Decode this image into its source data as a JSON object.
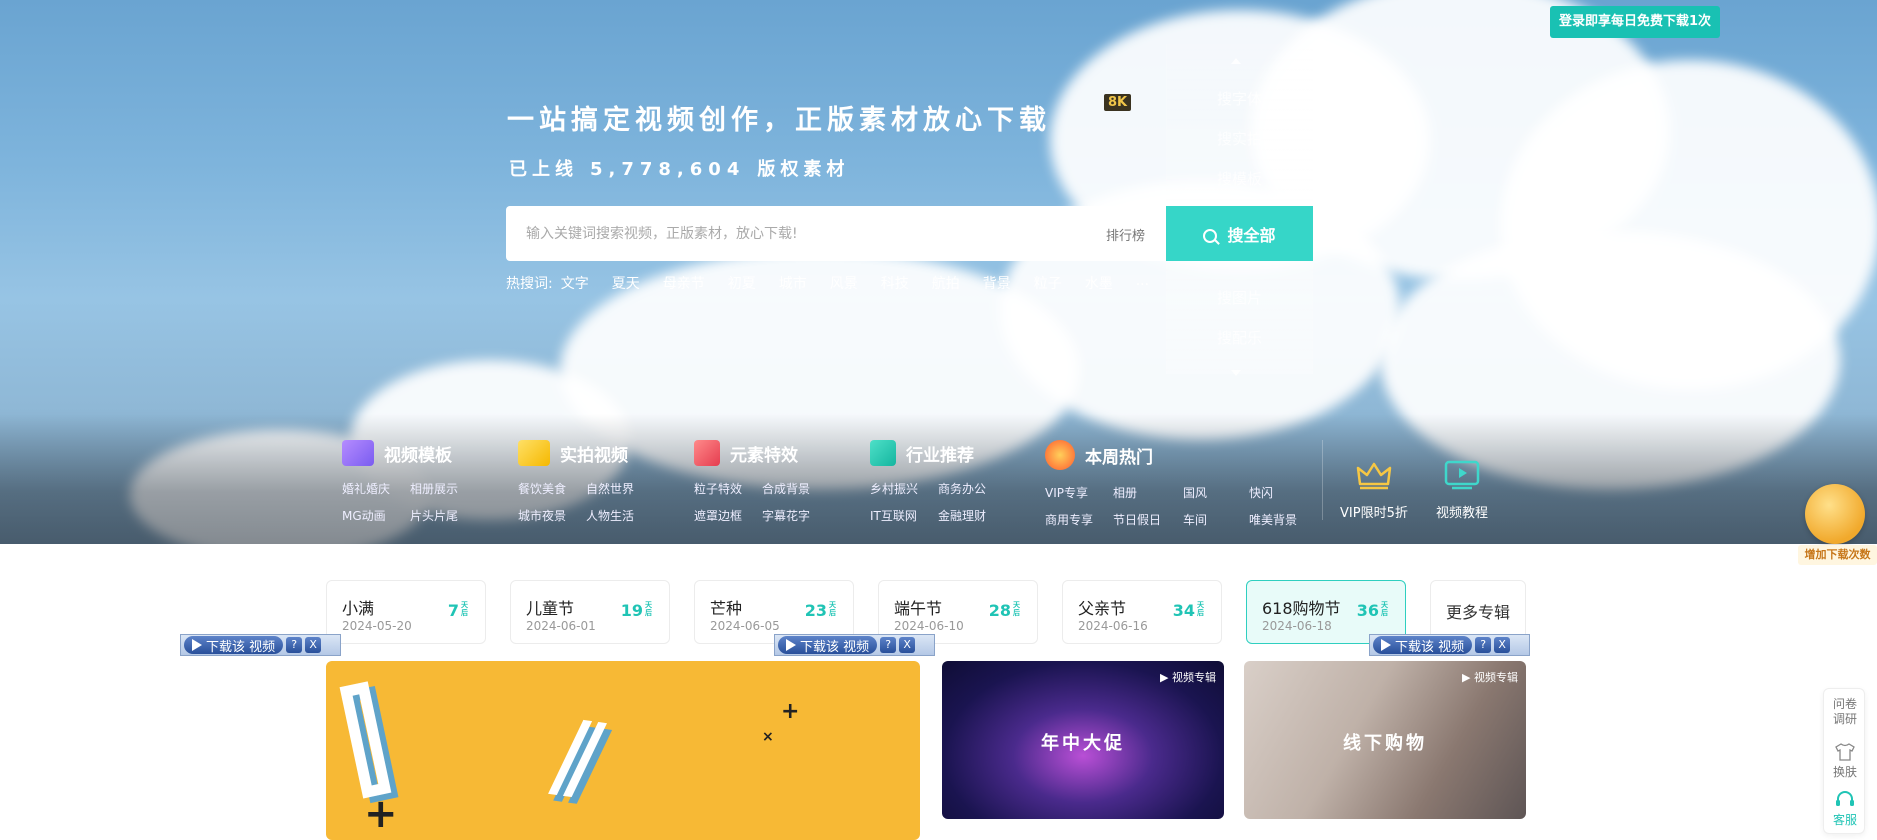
{
  "login_banner": "登录即享每日免费下载1次",
  "hero": {
    "headline": "一站搞定视频创作，正版素材放心下载",
    "badge": "8K",
    "sub_prefix": "已上线",
    "sub_count": "5,778,604",
    "sub_suffix": "版权素材"
  },
  "search": {
    "placeholder": "输入关键词搜索视频，正版素材，放心下载!",
    "rank_link": "排行榜",
    "button_label": "搜全部",
    "dropdown": [
      "搜字体",
      "搜实拍",
      "搜模板",
      "搜图片",
      "搜配乐"
    ]
  },
  "hot": {
    "label": "热搜词:",
    "terms": [
      "文字",
      "夏天",
      "母亲节",
      "初夏",
      "城市",
      "风景",
      "科技",
      "航拍",
      "背景",
      "粒子",
      "水墨",
      "..."
    ]
  },
  "categories": [
    {
      "title": "视频模板",
      "links": [
        "婚礼婚庆",
        "相册展示",
        "MG动画",
        "片头片尾"
      ]
    },
    {
      "title": "实拍视频",
      "links": [
        "餐饮美食",
        "自然世界",
        "城市夜景",
        "人物生活"
      ]
    },
    {
      "title": "元素特效",
      "links": [
        "粒子特效",
        "合成背景",
        "遮罩边框",
        "字幕花字"
      ]
    },
    {
      "title": "行业推荐",
      "links": [
        "乡村振兴",
        "商务办公",
        "IT互联网",
        "金融理财"
      ]
    },
    {
      "title": "本周热门",
      "links": [
        "VIP专享",
        "相册",
        "国风",
        "快闪",
        "商用专享",
        "节日假日",
        "车间",
        "唯美背景"
      ]
    }
  ],
  "side_tiles": {
    "vip": "VIP限时5折",
    "tutorial": "视频教程"
  },
  "float_coin_label": "增加下载次数",
  "festivals": [
    {
      "name": "小满",
      "date": "2024-05-20",
      "days": "7",
      "unit": "天后"
    },
    {
      "name": "儿童节",
      "date": "2024-06-01",
      "days": "19",
      "unit": "天后"
    },
    {
      "name": "芒种",
      "date": "2024-06-05",
      "days": "23",
      "unit": "天后"
    },
    {
      "name": "端午节",
      "date": "2024-06-10",
      "days": "28",
      "unit": "天后"
    },
    {
      "name": "父亲节",
      "date": "2024-06-16",
      "days": "34",
      "unit": "天后"
    },
    {
      "name": "618购物节",
      "date": "2024-06-18",
      "days": "36",
      "unit": "天后"
    }
  ],
  "festival_more": "更多专辑",
  "download_bar": {
    "label": "下载该 视频",
    "help": "?",
    "close": "X"
  },
  "cards": {
    "tag": "▶ 视频专辑",
    "c618_title": "年中大促",
    "shop_title": "线下购物"
  },
  "right_panel": {
    "survey": "问卷调研",
    "skin": "换肤",
    "service": "客服"
  },
  "colors": {
    "accent": "#36d6c8",
    "accent_dark": "#20c4b5",
    "banner": "#19c1b3"
  }
}
